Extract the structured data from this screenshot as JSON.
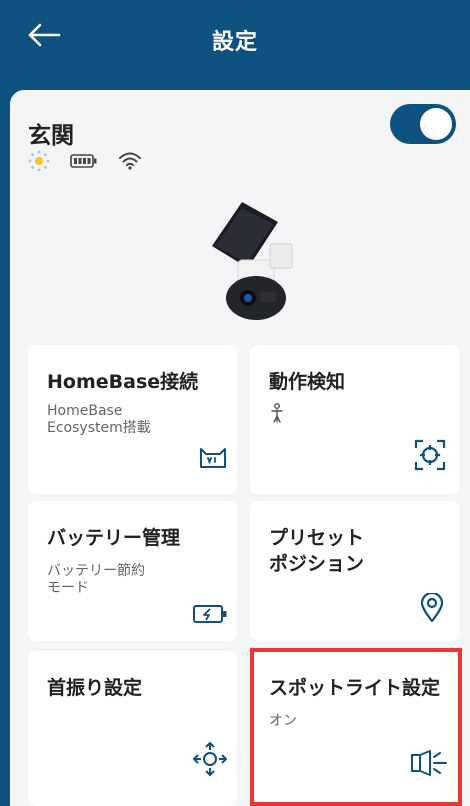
{
  "header": {
    "title": "設定"
  },
  "device": {
    "name": "玄関",
    "enabled": true
  },
  "status_icons": [
    "brightness-icon",
    "battery-icon",
    "wifi-icon"
  ],
  "cards": {
    "homebase": {
      "title": "HomeBase接続",
      "subtitle": "HomeBase\nEcosystem搭載",
      "icon": "homebase-icon"
    },
    "motion": {
      "title": "動作検知",
      "icon": "motion-detect-icon",
      "indicator": "person-icon"
    },
    "battery": {
      "title": "バッテリー管理",
      "subtitle": "バッテリー節約\nモード",
      "icon": "battery-charge-icon"
    },
    "preset": {
      "title": "プリセット\nポジション",
      "icon": "location-pin-icon"
    },
    "pan": {
      "title": "首振り設定",
      "icon": "pan-tilt-icon"
    },
    "spotlight": {
      "title": "スポットライト設定",
      "subtitle": "オン",
      "icon": "spotlight-icon"
    }
  },
  "colors": {
    "primary": "#0e5282",
    "highlight": "#e53935",
    "background": "#f4f5f7"
  }
}
